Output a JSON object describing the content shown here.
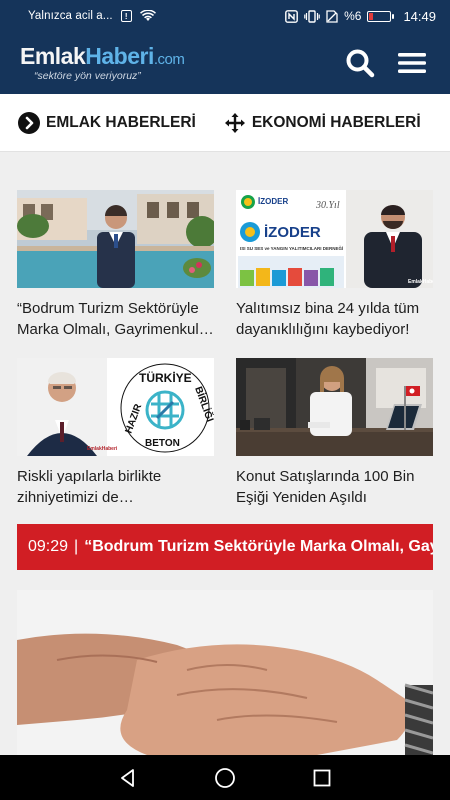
{
  "status_bar": {
    "carrier": "Yalnızca acil a...",
    "badge": "!",
    "battery": "%6",
    "time": "14:49"
  },
  "header": {
    "logo_part1": "Emlak",
    "logo_part2": "Haberi",
    "logo_part3": ".com",
    "slogan": "“sektöre yön veriyoruz”"
  },
  "categories": [
    {
      "label": "EMLAK HABERLERİ",
      "icon": "circle-chevron-icon"
    },
    {
      "label": "EKONOMİ HABERLERİ",
      "icon": "move-arrows-icon"
    }
  ],
  "articles": [
    {
      "title": "“Bodrum Turizm Sektörüyle Marka Olmalı, Gayrimenkul Değerleri Yükselmeli”"
    },
    {
      "title": "Yalıtımsız bina 24 yılda tüm dayanıklılığını kaybediyor!",
      "image_text": {
        "brand": "İZODER",
        "sub": "ISI SU SES ve YANGIN YALITIMCILARI DERNEĞİ",
        "anniv": "30.Yıl"
      }
    },
    {
      "title": "Riskli yapılarla birlikte zihniyetimizi de değiştirmeliyiz",
      "image_text": {
        "top": "TÜRKİYE",
        "left": "HAZIR",
        "bottom": "BETON",
        "right": "BİRLİĞİ"
      }
    },
    {
      "title": "Konut Satışlarında 100 Bin Eşiği Yeniden Aşıldı"
    }
  ],
  "ticker": {
    "time": "09:29",
    "separator": "|",
    "text": "“Bodrum Turizm Sektörüyle Marka Olmalı, Gayrimenkul Değerleri Yükselmeli”"
  },
  "colors": {
    "header_bg": "#15345a",
    "ticker_bg": "#d11e24",
    "page_bg": "#efefef"
  }
}
